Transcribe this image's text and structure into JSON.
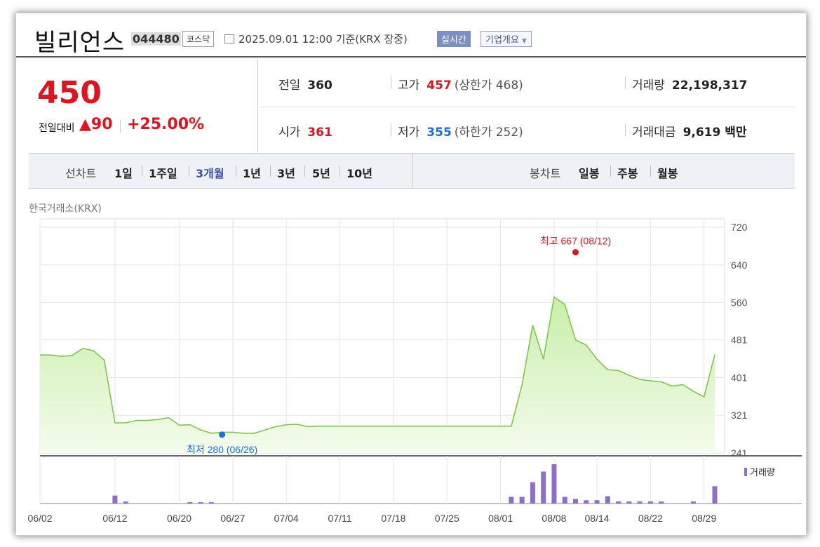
{
  "header": {
    "name": "빌리언스",
    "code": "044480",
    "market": "코스닥",
    "date": "2025.09.01 12:00 기준(KRX 장중)",
    "realtime": "실시간",
    "company_info": "기업개요"
  },
  "summary": {
    "price": "450",
    "change_label": "전일대비",
    "change_value": "▲90",
    "change_pct": "+25.00%",
    "prev_label": "전일",
    "prev": "360",
    "high_label": "고가",
    "high": "457",
    "upper_label": "(상한가 468)",
    "volume_label": "거래량",
    "volume": "22,198,317",
    "open_label": "시가",
    "open": "361",
    "low_label": "저가",
    "low": "355",
    "lower_label": "(하한가 252)",
    "amount_label": "거래대금",
    "amount": "9,619 백만"
  },
  "periods": {
    "line_label": "선차트",
    "line_items": [
      "1일",
      "1주일",
      "3개월",
      "1년",
      "3년",
      "5년",
      "10년"
    ],
    "active": "3개월",
    "candle_label": "봉차트",
    "candle_items": [
      "일봉",
      "주봉",
      "월봉"
    ]
  },
  "chart_source": "한국거래소(KRX)",
  "colors": {
    "up": "#e0141e",
    "down": "#1c6ee0",
    "line": "#7cc84a",
    "volume": "#8d6fc9"
  },
  "chart_data": {
    "type": "area",
    "ylim": [
      241,
      720
    ],
    "yticks": [
      "720",
      "640",
      "560",
      "481",
      "401",
      "321",
      "241"
    ],
    "xticks": [
      "06/02",
      "06/12",
      "06/20",
      "06/27",
      "07/04",
      "07/11",
      "07/18",
      "07/25",
      "08/01",
      "08/08",
      "08/14",
      "08/22",
      "08/29"
    ],
    "x": [
      "06/02",
      "06/03",
      "06/04",
      "06/05",
      "06/09",
      "06/10",
      "06/11",
      "06/12",
      "06/13",
      "06/16",
      "06/17",
      "06/18",
      "06/19",
      "06/20",
      "06/23",
      "06/24",
      "06/25",
      "06/26",
      "06/27",
      "06/30",
      "07/01",
      "07/02",
      "07/03",
      "07/04",
      "07/07",
      "07/08",
      "07/09",
      "07/10",
      "07/11",
      "07/14",
      "07/15",
      "07/16",
      "07/17",
      "07/18",
      "07/21",
      "07/22",
      "07/23",
      "07/24",
      "07/25",
      "07/28",
      "07/29",
      "07/30",
      "07/31",
      "08/01",
      "08/04",
      "08/05",
      "08/06",
      "08/07",
      "08/08",
      "08/11",
      "08/12",
      "08/13",
      "08/14",
      "08/18",
      "08/19",
      "08/20",
      "08/21",
      "08/22",
      "08/25",
      "08/26",
      "08/27",
      "08/28",
      "08/29",
      "09/01"
    ],
    "values": [
      449,
      449,
      446,
      448,
      463,
      458,
      438,
      305,
      305,
      310,
      310,
      312,
      316,
      300,
      301,
      290,
      283,
      285,
      285,
      283,
      283,
      290,
      297,
      301,
      302,
      297,
      298,
      298,
      298,
      298,
      298,
      298,
      298,
      298,
      298,
      298,
      298,
      298,
      298,
      298,
      298,
      298,
      298,
      298,
      298,
      385,
      512,
      440,
      572,
      556,
      481,
      470,
      440,
      418,
      416,
      406,
      397,
      394,
      392,
      383,
      386,
      372,
      360,
      450
    ],
    "volume_label": "거래량",
    "volume": [
      0,
      0,
      0,
      0,
      0,
      0,
      0,
      12,
      3,
      0,
      0,
      0,
      0,
      0,
      2,
      2,
      2,
      0,
      0,
      0,
      0,
      0,
      0,
      0,
      0,
      0,
      0,
      0,
      0,
      0,
      0,
      0,
      0,
      0,
      0,
      0,
      0,
      0,
      0,
      0,
      0,
      0,
      0,
      0,
      10,
      10,
      32,
      48,
      59,
      10,
      7,
      5,
      5,
      11,
      3,
      3,
      3,
      3,
      3,
      0,
      0,
      3,
      0,
      26
    ],
    "max": {
      "label": "최고 667 (08/12)",
      "date": "08/12",
      "value": 667
    },
    "min": {
      "label": "최저 280 (06/26)",
      "date": "06/26",
      "value": 280
    }
  }
}
